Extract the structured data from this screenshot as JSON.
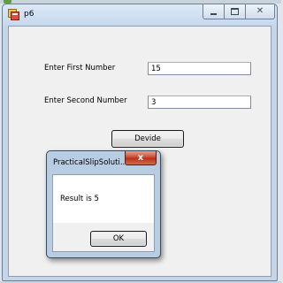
{
  "window": {
    "title": "p6",
    "icon": "forms-app-icon",
    "controls": {
      "minimize": "minimize-icon",
      "maximize": "maximize-icon",
      "close": "close-icon"
    }
  },
  "form": {
    "first_label": "Enter First Number",
    "first_value": "15",
    "second_label": "Enter Second Number",
    "second_value": "3",
    "divide_button": "Devide"
  },
  "message_box": {
    "title": "PracticalSlipSoluti...",
    "message": "Result is 5",
    "ok_button": "OK",
    "close_glyph": "x"
  },
  "colors": {
    "client_bg": "#f0f0f0",
    "frame_bg": "#c4d6e8",
    "close_button": "#c7442a"
  }
}
